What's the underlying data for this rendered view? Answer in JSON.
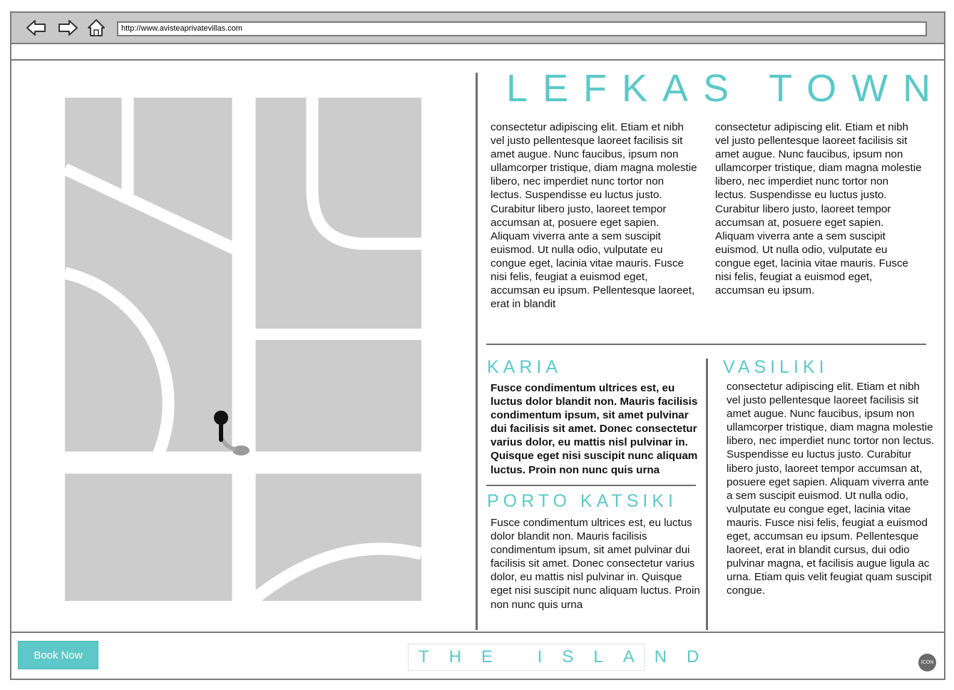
{
  "browser": {
    "url": "http://www.avisteaprivatevillas.com",
    "back_icon": "back-arrow-icon",
    "forward_icon": "forward-arrow-icon",
    "home_icon": "home-icon"
  },
  "main": {
    "title": "LEFKAS TOWN",
    "col1": "consectetur adipiscing elit. Etiam et nibh vel justo pellentesque laoreet facilisis sit amet augue. Nunc faucibus, ipsum non ullamcorper tristique, diam magna molestie libero, nec imperdiet nunc tortor non lectus. Suspendisse eu luctus justo. Curabitur libero justo, laoreet tempor accumsan at, posuere eget sapien. Aliquam viverra ante a sem suscipit euismod. Ut nulla odio, vulputate eu congue eget, lacinia vitae mauris. Fusce nisi felis, feugiat a euismod eget, accumsan eu ipsum. Pellentesque laoreet, erat in blandit",
    "col2": "consectetur adipiscing elit. Etiam et nibh vel justo pellentesque laoreet facilisis sit amet augue. Nunc faucibus, ipsum non ullamcorper tristique, diam magna molestie libero, nec imperdiet nunc tortor non lectus. Suspendisse eu luctus justo. Curabitur libero justo, laoreet tempor accumsan at, posuere eget sapien. Aliquam viverra ante a sem suscipit euismod. Ut nulla odio, vulputate eu congue eget, lacinia vitae mauris. Fusce nisi felis, feugiat a euismod eget, accumsan eu ipsum."
  },
  "sections": {
    "karia": {
      "title": "KARIA",
      "text": "Fusce condimentum ultrices est, eu luctus dolor blandit non. Mauris facilisis condimentum ipsum, sit amet pulvinar dui facilisis sit amet. Donec consectetur varius dolor, eu mattis nisl pulvinar in. Quisque eget nisi suscipit nunc aliquam luctus. Proin non nunc quis urna"
    },
    "porto": {
      "title": "PORTO KATSIKI",
      "text": "Fusce condimentum ultrices est, eu luctus dolor blandit non. Mauris facilisis condimentum ipsum, sit amet pulvinar dui facilisis sit amet. Donec consectetur varius dolor, eu mattis nisl pulvinar in. Quisque eget nisi suscipit nunc aliquam luctus. Proin non nunc quis urna"
    },
    "vasiliki": {
      "title": "VASILIKI",
      "text": "consectetur adipiscing elit. Etiam et nibh vel justo pellentesque laoreet facilisis sit amet augue. Nunc faucibus, ipsum non ullamcorper tristique, diam magna molestie libero, nec imperdiet nunc tortor non lectus. Suspendisse eu luctus justo. Curabitur libero justo, laoreet tempor accumsan at, posuere eget sapien. Aliquam viverra ante a sem suscipit euismod. Ut nulla odio, vulputate eu congue eget, lacinia vitae mauris. Fusce nisi felis, feugiat a euismod eget, accumsan eu ipsum. Pellentesque laoreet, erat in blandit cursus, dui odio pulvinar magna, et facilisis augue ligula ac urna. Etiam quis velit feugiat quam suscipit congue."
    }
  },
  "footer": {
    "book_label": "Book Now",
    "island_label": "THE ISLAND",
    "icon_label": "ICON"
  },
  "colors": {
    "accent": "#5cc8c8",
    "frame": "#7a7a7a",
    "map_block": "#cccccc"
  }
}
